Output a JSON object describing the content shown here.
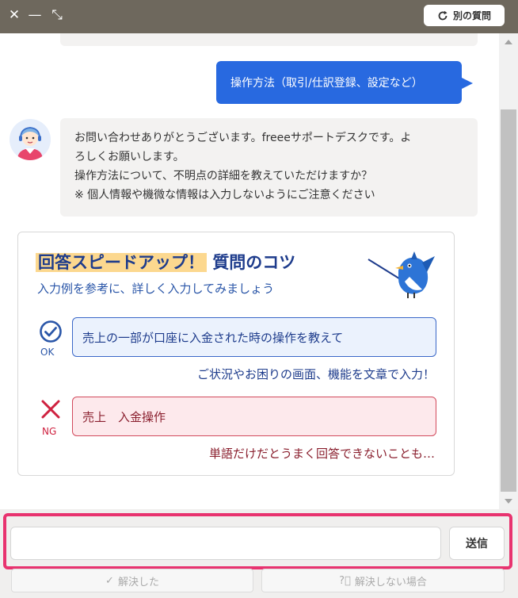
{
  "topbar": {
    "new_question_label": "別の質問",
    "close_glyph": "✕",
    "minimize_glyph": "—",
    "shrink_glyph": "⤡",
    "bg_color": "#6e685d"
  },
  "chat": {
    "user_message": "操作方法（取引/仕訳登録、設定など）",
    "bot_lines": [
      "お問い合わせありがとうございます。freeeサポートデスクです。よ",
      "ろしくお願いします。",
      "操作方法について、不明点の詳細を教えていただけますか？",
      "※ 個人情報や機微な情報は入力しないようにご注意ください"
    ],
    "user_bubble_color": "#2869e0"
  },
  "tips": {
    "title_highlight": "回答スピードアップ！",
    "title_rest": "質問のコツ",
    "subtitle": "入力例を参考に、詳しく入力してみましょう",
    "ok_label": "OK",
    "ok_example": "売上の一部が口座に入金された時の操作を教えて",
    "ok_note": "ご状況やお困りの画面、機能を文章で入力！",
    "ng_label": "NG",
    "ng_example": "売上　入金操作",
    "ng_note": "単語だけだとうまく回答できないことも…"
  },
  "composer": {
    "input_value": "",
    "send_label": "送信",
    "resolved_label": "解決した",
    "unresolved_label": "解決しない場合",
    "highlight_color": "#e8336f"
  }
}
